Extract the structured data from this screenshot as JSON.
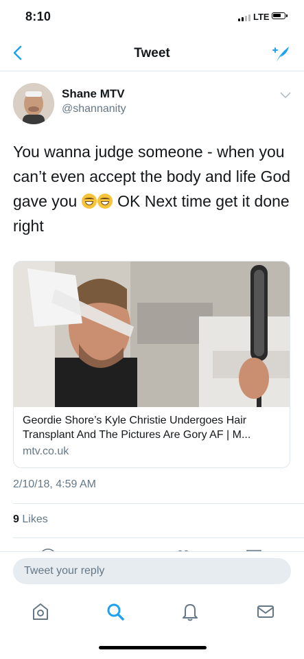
{
  "status_bar": {
    "time": "8:10",
    "network": "LTE"
  },
  "nav": {
    "title": "Tweet"
  },
  "tweet": {
    "author_name": "Shane MTV",
    "handle": "@shannanity",
    "text_part1": "You wanna judge someone - when you can’t even accept the body and life God gave you ",
    "text_part2": " OK  Next time get it done right",
    "timestamp": "2/10/18, 4:59 AM",
    "likes_count": "9",
    "likes_label": "Likes"
  },
  "card": {
    "title": "Geordie Shore’s Kyle Christie Undergoes Hair Transplant And The Pictures Are Gory AF | M...",
    "domain": "mtv.co.uk"
  },
  "reply": {
    "placeholder": "Tweet your reply"
  },
  "tab_bar": {
    "icons": [
      "home-icon",
      "search-icon",
      "notifications-icon",
      "messages-icon"
    ]
  },
  "colors": {
    "accent": "#1da1f2",
    "secondary_text": "#657786"
  }
}
